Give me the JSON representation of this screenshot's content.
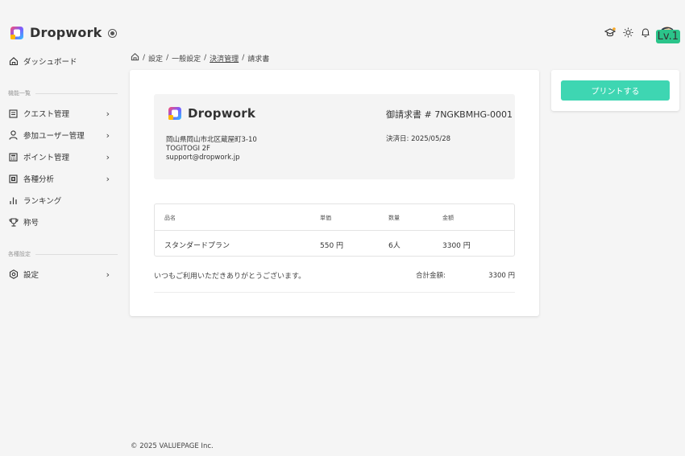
{
  "app": {
    "brand": "Dropwork"
  },
  "sidebar": {
    "dashboard": "ダッシュボード",
    "section_functions": "機能一覧",
    "items": [
      {
        "label": "クエスト管理",
        "icon": "list-icon",
        "chevron": "›"
      },
      {
        "label": "参加ユーザー管理",
        "icon": "user-icon",
        "chevron": "›"
      },
      {
        "label": "ポイント管理",
        "icon": "calculator-icon",
        "chevron": "›"
      },
      {
        "label": "各種分析",
        "icon": "analytics-icon",
        "chevron": "›"
      },
      {
        "label": "ランキング",
        "icon": "bar-chart-icon"
      },
      {
        "label": "称号",
        "icon": "trophy-icon"
      }
    ],
    "section_settings": "各種設定",
    "settings": {
      "label": "設定",
      "icon": "gear-icon",
      "chevron": "›"
    }
  },
  "header": {
    "avatar_badge": "Lv.1"
  },
  "breadcrumb": {
    "home": "⌂",
    "sep": "/",
    "items": [
      "設定",
      "一般設定",
      "決済管理",
      "請求書"
    ]
  },
  "invoice": {
    "brand": "Dropwork",
    "address": [
      "岡山県岡山市北区蔵屋町3-10",
      "TOGITOGI 2F",
      "support@dropwork.jp"
    ],
    "number": "御請求書 # 7NGKBMHG-0001",
    "date": "決済日: 2025/05/28",
    "table": {
      "headers": [
        "品名",
        "単価",
        "数量",
        "金額"
      ],
      "rows": [
        [
          "スタンダードプラン",
          "550 円",
          "6人",
          "3300 円"
        ]
      ]
    },
    "thanks": "いつもご利用いただきありがとうございます。",
    "total_label": "合計金額:",
    "total_value": "3300 円"
  },
  "actions": {
    "print": "プリントする"
  },
  "footer": {
    "copyright": "© 2025  VALUEPAGE Inc."
  },
  "colors": {
    "accent": "#3ed6b2",
    "badge": "#2bc48a"
  }
}
